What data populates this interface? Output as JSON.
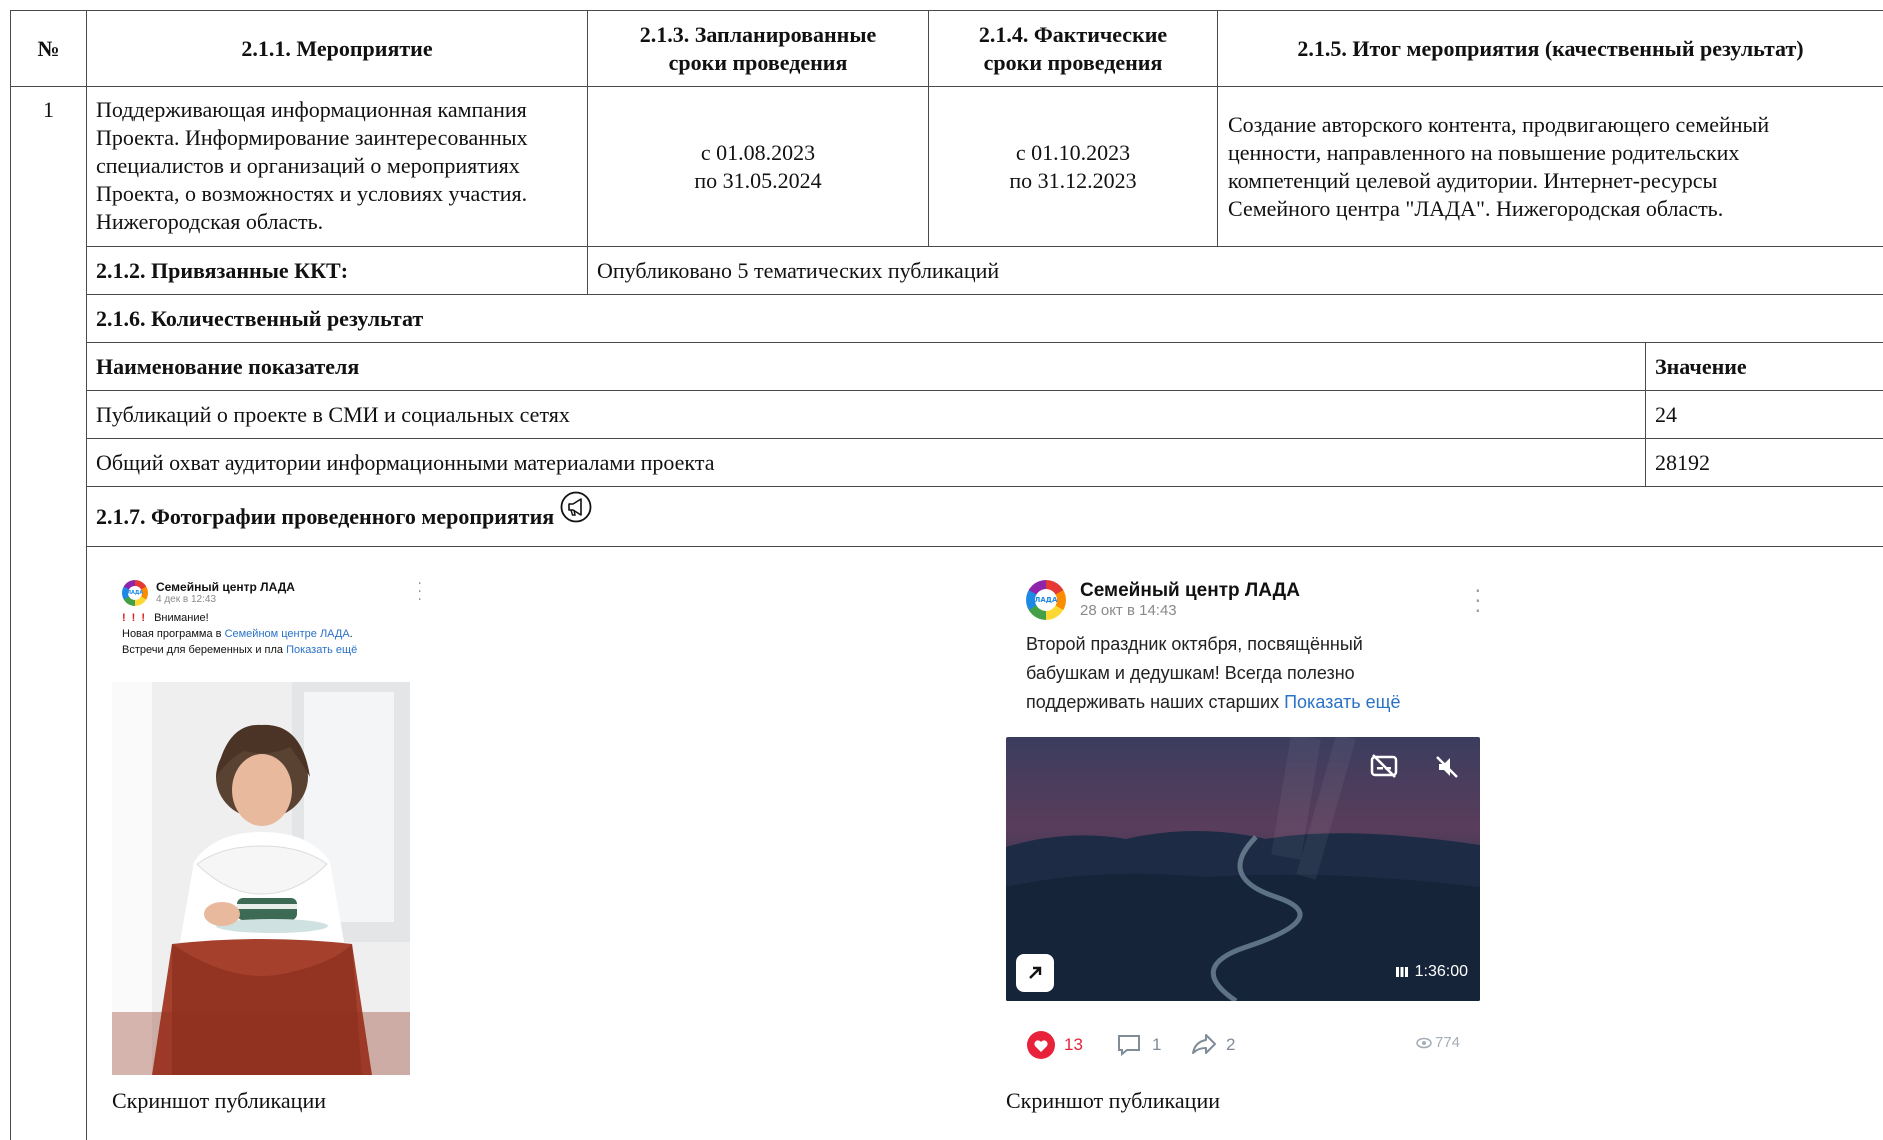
{
  "headers": {
    "num": "№",
    "event": "2.1.1. Мероприятие",
    "planned": [
      "2.1.3. Запланированные",
      "сроки проведения"
    ],
    "actual": [
      "2.1.4. Фактические",
      "сроки проведения"
    ],
    "result": "2.1.5. Итог мероприятия (качественный результат)"
  },
  "row": {
    "num": "1",
    "event_lines": [
      "Поддерживающая информационная кампания",
      "Проекта. Информирование заинтересованных",
      "специалистов и организаций о мероприятиях",
      "Проекта, о возможностях и условиях участия.",
      "Нижегородская область."
    ],
    "planned": [
      "с 01.08.2023",
      "по 31.05.2024"
    ],
    "actual": [
      "с 01.10.2023",
      "по 31.12.2023"
    ],
    "result_lines": [
      "Создание авторского контента, продвигающего семейный",
      "ценности, направленного на повышение родительских",
      "компетенций целевой аудитории. Интернет-ресурсы",
      "Семейного центра \"ЛАДА\". Нижегородская область."
    ]
  },
  "kkt": {
    "label": "2.1.2. Привязанные ККТ:",
    "value": "Опубликовано 5 тематических публикаций"
  },
  "quant": {
    "label": "2.1.6. Количественный результат",
    "col_name": "Наименование показателя",
    "col_value": "Значение",
    "rows": [
      {
        "name": "Публикаций о проекте в СМИ и социальных сетях",
        "value": "24"
      },
      {
        "name": "Общий охват аудитории информационными материалами проекта",
        "value": "28192"
      }
    ]
  },
  "photos": {
    "label": "2.1.7. Фотографии проведенного мероприятия",
    "icon": "megaphone-icon",
    "items": [
      {
        "caption": "Скриншот публикации",
        "author": "Семейный центр ЛАДА",
        "date": "4 дек в 12:43",
        "alert": "Внимание!",
        "text1_prefix": "Новая программа в ",
        "text1_link": "Семейном центре ЛАДА",
        "text1_suffix": ".",
        "text2": "Встречи для беременных и пла",
        "more": "Показать ещё"
      },
      {
        "caption": "Скриншот публикации",
        "author": "Семейный центр ЛАДА",
        "date": "28 окт в 14:43",
        "text_lines": [
          "Второй праздник октября, посвящённый",
          "бабушкам и дедушкам! Всегда полезно",
          "поддерживать наших старших"
        ],
        "more": "Показать ещё",
        "duration": "1:36:00",
        "likes": "13",
        "comments": "1",
        "shares": "2",
        "views": "774"
      }
    ]
  },
  "logo_text": "ЛАДА",
  "colors": {
    "border": "#4a4a4a",
    "link": "#2a72c8",
    "like": "#e8223a",
    "alert": "#d91c1c"
  }
}
